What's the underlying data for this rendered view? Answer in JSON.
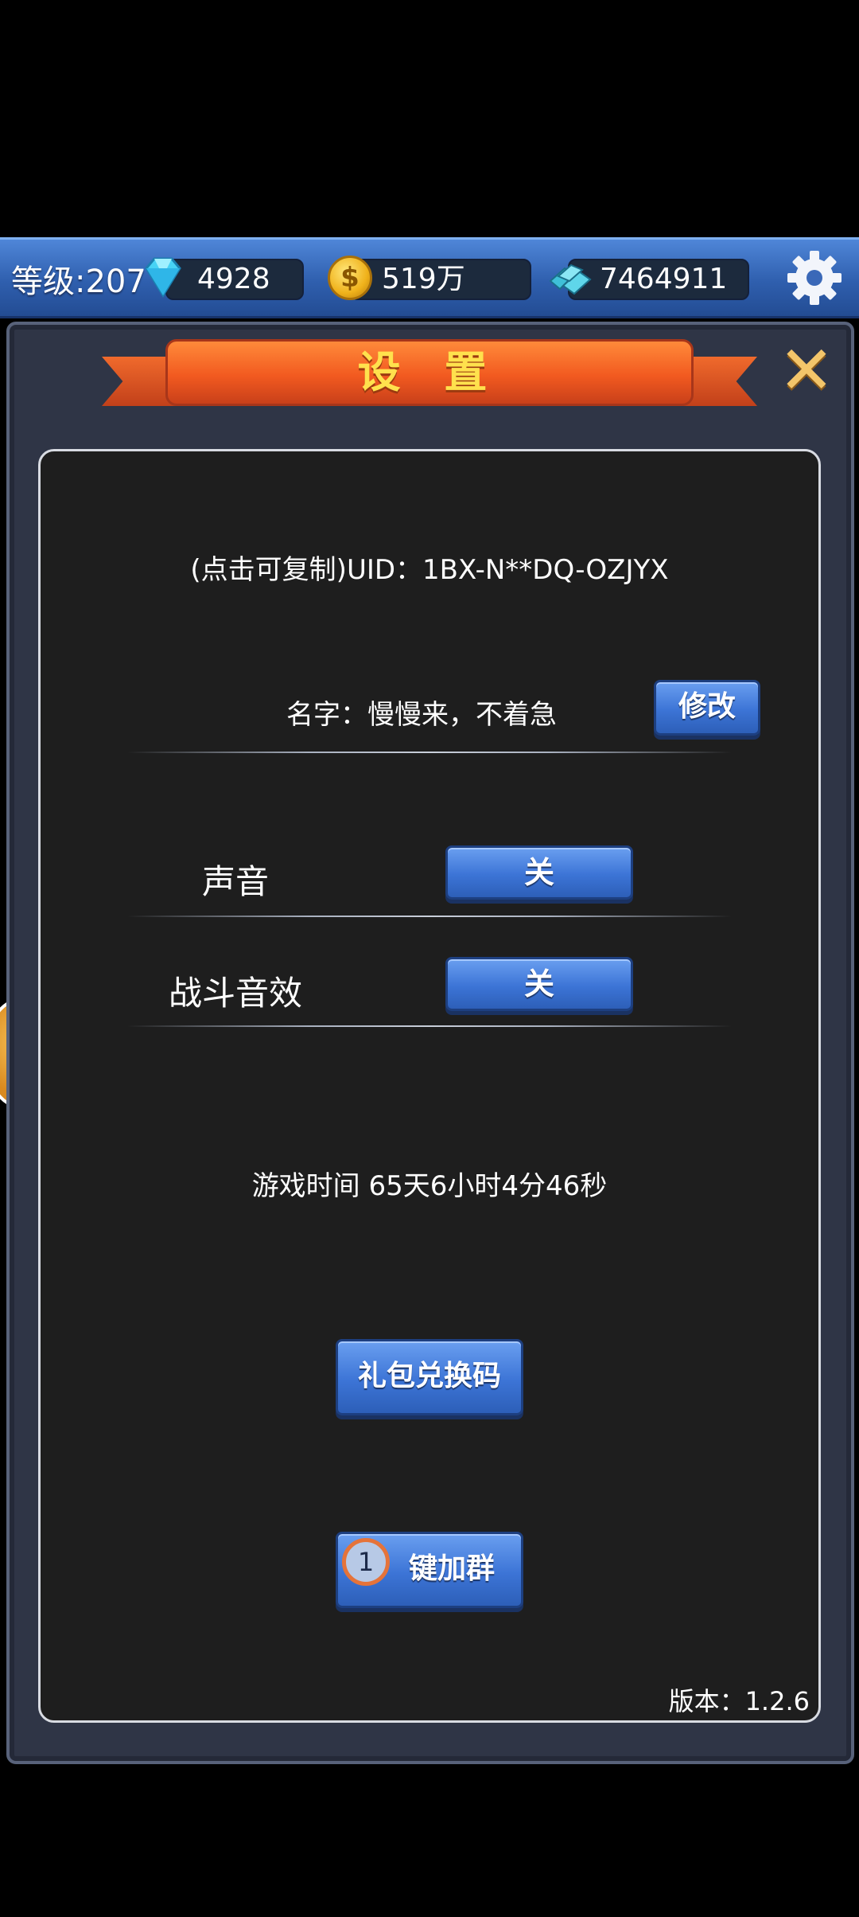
{
  "topbar": {
    "level": "等级:207",
    "gems": "4928",
    "gold": "519万",
    "crystals": "7464911",
    "icons": {
      "gem": "diamond-icon",
      "gold": "gold-coin-icon",
      "crystal": "crystal-icon",
      "settings": "gear-icon"
    },
    "coin_symbol": "$"
  },
  "dialog": {
    "title": "设 置",
    "close_glyph": "✕",
    "uid_text": "(点击可复制)UID：1BX-N**DQ-OZJYX",
    "name_text": "名字：慢慢来，不着急",
    "edit_label": "修改",
    "sound_label": "声音",
    "sound_value": "关",
    "battle_sfx_label": "战斗音效",
    "battle_sfx_value": "关",
    "playtime": "游戏时间 65天6小时4分46秒",
    "gift_code_label": "礼包兑换码",
    "join_group_badge": "1",
    "join_group_label": "键加群",
    "version": "版本：1.2.6"
  },
  "colors": {
    "button_blue": "#3c74d6",
    "ribbon_orange": "#f25a20",
    "title_yellow": "#ffe14d"
  }
}
